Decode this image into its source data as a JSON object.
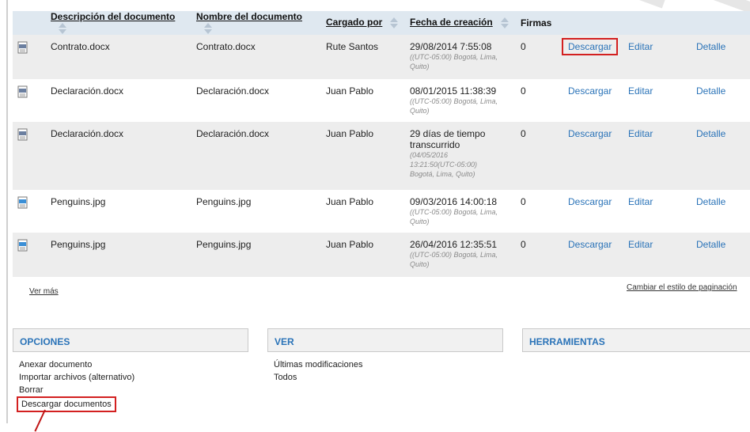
{
  "columns": [
    {
      "label": "Descripción del documento",
      "sortable": true
    },
    {
      "label": "Nombre del documento",
      "sortable": true
    },
    {
      "label": "Cargado por",
      "sortable": true
    },
    {
      "label": "Fecha de creación",
      "sortable": true
    },
    {
      "label": "Firmas",
      "sortable": false
    }
  ],
  "rows": [
    {
      "description": "Contrato.docx",
      "name": "Contrato.docx",
      "uploaded_by": "Rute Santos",
      "date_main": "29/08/2014 7:55:08",
      "date_sub": "((UTC-05:00) Bogotá, Lima, Quito)",
      "signatures": "0",
      "download": "Descargar",
      "edit": "Editar",
      "detail": "Detalle",
      "icon": "word-doc-icon"
    },
    {
      "description": "Declaración.docx",
      "name": "Declaración.docx",
      "uploaded_by": "Juan Pablo",
      "date_main": "08/01/2015 11:38:39",
      "date_sub": "((UTC-05:00) Bogotá, Lima, Quito)",
      "signatures": "0",
      "download": "Descargar",
      "edit": "Editar",
      "detail": "Detalle",
      "icon": "word-doc-icon"
    },
    {
      "description": "Declaración.docx",
      "name": "Declaración.docx",
      "uploaded_by": "Juan Pablo",
      "date_main": "29 días de tiempo transcurrido",
      "date_sub": "(04/05/2016 13:21:50(UTC-05:00) Bogotá, Lima, Quito)",
      "signatures": "0",
      "download": "Descargar",
      "edit": "Editar",
      "detail": "Detalle",
      "icon": "word-doc-icon"
    },
    {
      "description": "Penguins.jpg",
      "name": "Penguins.jpg",
      "uploaded_by": "Juan Pablo",
      "date_main": "09/03/2016 14:00:18",
      "date_sub": "((UTC-05:00) Bogotá, Lima, Quito)",
      "signatures": "0",
      "download": "Descargar",
      "edit": "Editar",
      "detail": "Detalle",
      "icon": "image-doc-icon"
    },
    {
      "description": "Penguins.jpg",
      "name": "Penguins.jpg",
      "uploaded_by": "Juan Pablo",
      "date_main": "26/04/2016 12:35:51",
      "date_sub": "((UTC-05:00) Bogotá, Lima, Quito)",
      "signatures": "0",
      "download": "Descargar",
      "edit": "Editar",
      "detail": "Detalle",
      "icon": "image-doc-icon"
    }
  ],
  "footer": {
    "ver_mas": "Ver más",
    "cambiar": "Cambiar el estilo de paginación"
  },
  "panels": {
    "opciones": {
      "title": "OPCIONES",
      "items": [
        "Anexar documento",
        "Importar archivos (alternativo)",
        "Borrar",
        "Descargar documentos"
      ]
    },
    "ver": {
      "title": "VER",
      "items": [
        "Últimas modificaciones",
        "Todos"
      ]
    },
    "herramientas": {
      "title": "HERRAMIENTAS",
      "items": []
    }
  },
  "colors": {
    "link": "#2a73b8",
    "highlight": "#d32020",
    "header_bg": "#dfe8f0"
  }
}
